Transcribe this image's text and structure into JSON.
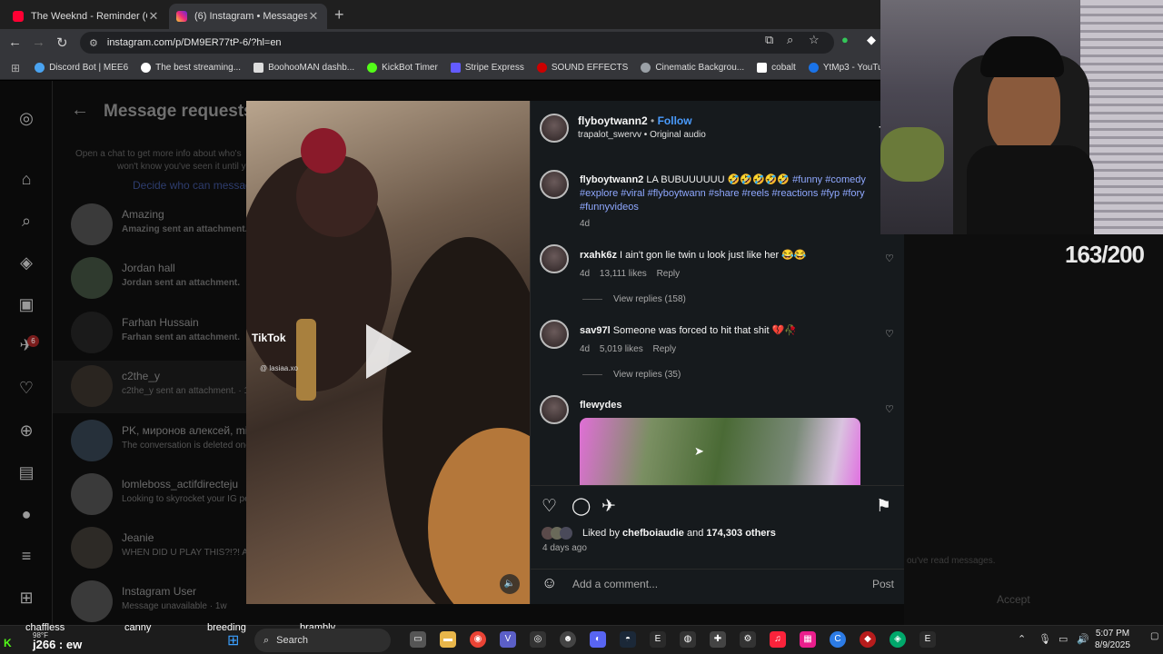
{
  "browser": {
    "tabs": [
      {
        "title": "The Weeknd - Reminder (Offici",
        "active": false,
        "favicon_color": "#ff0033"
      },
      {
        "title": "(6) Instagram • Messages",
        "active": true,
        "favicon_color": "#d6249f"
      }
    ],
    "url": "instagram.com/p/DM9ER77tP-6/?hl=en",
    "bookmarks": [
      {
        "label": "Discord Bot | MEE6",
        "color": "#4aa3f0"
      },
      {
        "label": "The best streaming...",
        "color": "#ffffff"
      },
      {
        "label": "BoohooMAN dashb...",
        "color": "#dddddd"
      },
      {
        "label": "KickBot Timer",
        "color": "#53fc18"
      },
      {
        "label": "Stripe Express",
        "color": "#635bff"
      },
      {
        "label": "SOUND EFFECTS",
        "color": "#cc0000"
      },
      {
        "label": "Cinematic Backgrou...",
        "color": "#9aa0a6"
      },
      {
        "label": "cobalt",
        "color": "#ffffff"
      },
      {
        "label": "YtMp3 - YouTube to...",
        "color": "#1a73e8"
      },
      {
        "label": "ytmp",
        "color": "#1a73e8"
      }
    ]
  },
  "messages": {
    "header": "Message requests",
    "info": "Open a chat to get more info about who's messaging you. They won't know you've seen it until you accept.",
    "info_line1": "Open a chat to get more info about who's",
    "info_line2": "won't know you've seen it until y",
    "decide_link": "Decide who can messag",
    "threads": [
      {
        "name": "Amazing",
        "preview": "Amazing sent an attachment."
      },
      {
        "name": "Jordan hall",
        "preview": "Jordan sent an attachment."
      },
      {
        "name": "Farhan Hussain",
        "preview": "Farhan sent an attachment."
      },
      {
        "name": "c2the_y",
        "preview": "c2the_y sent an attachment. · 1"
      },
      {
        "name": "PK, миронов алексей, mis",
        "preview": "The conversation is deleted onc"
      },
      {
        "name": "lomleboss_actifdirecteju",
        "preview": "Looking to skyrocket your IG pe"
      },
      {
        "name": "Jeanie",
        "preview": "WHEN DID U PLAY THIS?!?! AN"
      },
      {
        "name": "Instagram User",
        "preview": "Message unavailable · 1w"
      }
    ],
    "badge_count": "6",
    "read_notice": "ou've read messages.",
    "accept_label": "Accept"
  },
  "post": {
    "author": "flyboytwann2",
    "follow_label": "Follow",
    "audio": "trapalot_swervv • Original audio",
    "caption_text": "LA BUBUUUUUU 🤣🤣🤣🤣🤣",
    "caption_tags_1": "#funny #comedy",
    "caption_tags_2": "#explore #viral #flyboytwann #share #reels #reactions #fyp #fory",
    "caption_tags_3": "#funnyvideos",
    "caption_age": "4d",
    "comments": [
      {
        "user": "rxahk6z",
        "text": "I ain't gon lie twin u look just like her 😂😂",
        "age": "4d",
        "likes": "13,111 likes",
        "reply": "Reply",
        "view_replies": "View replies (158)"
      },
      {
        "user": "sav97l",
        "text": "Someone was forced to hit that shit 💔🥀",
        "age": "4d",
        "likes": "5,019 likes",
        "reply": "Reply",
        "view_replies": "View replies (35)"
      },
      {
        "user": "flewydes",
        "text": "",
        "age": "",
        "likes": "",
        "reply": "",
        "view_replies": ""
      }
    ],
    "liked_by_prefix": "Liked by",
    "liked_by_user": "chefboiaudie",
    "liked_by_and": "and",
    "liked_by_others": "174,303 others",
    "posted_ago": "4 days ago",
    "add_comment_placeholder": "Add a comment...",
    "post_label": "Post",
    "video_watermark": "TikTok",
    "video_handle": "@ lasiaa.xo"
  },
  "stream": {
    "counter": "163/200",
    "overlay_names": [
      "chaffless",
      "canny",
      "breeding",
      "brambly"
    ],
    "chat_user": "j266 : ew",
    "temperature": "98°F"
  },
  "taskbar": {
    "search_placeholder": "Search",
    "time": "5:07 PM",
    "date": "8/9/2025"
  }
}
